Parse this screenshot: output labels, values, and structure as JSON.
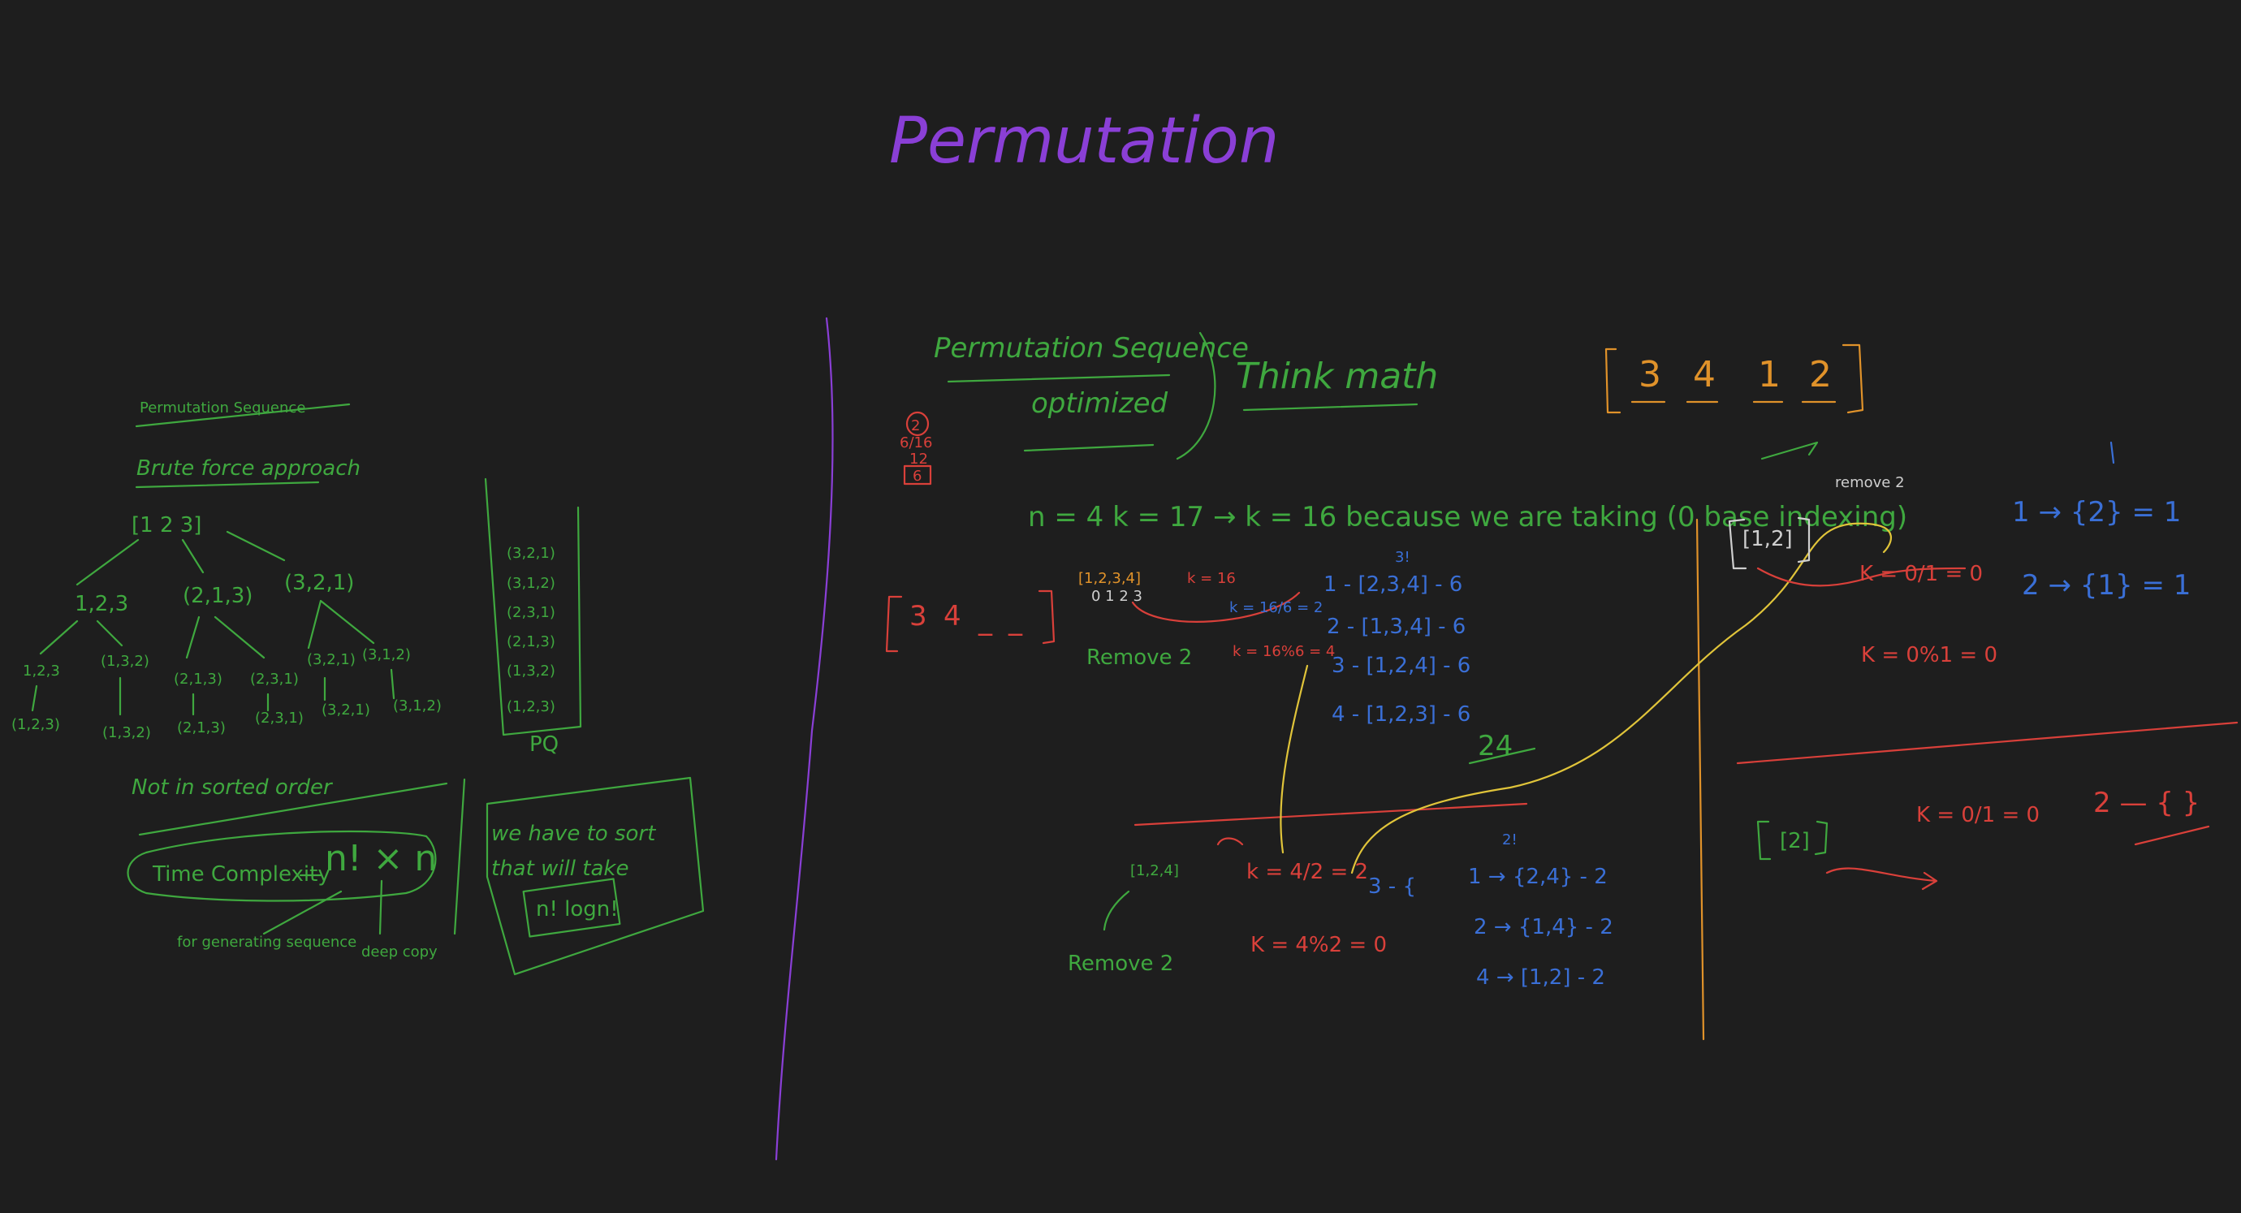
{
  "title": "Permutation",
  "left": {
    "heading": "Permutation Sequence",
    "approach": "Brute force approach",
    "root": "[1 2 3]",
    "level1": [
      "1,2,3",
      "(2,1,3)",
      "(3,2,1)"
    ],
    "level2": [
      "1,2,3",
      "(1,3,2)",
      "(2,1,3)",
      "(2,3,1)",
      "(3,2,1)",
      "(3,1,2)"
    ],
    "level3": [
      "(1,2,3)",
      "(1,3,2)",
      "(2,1,3)",
      "(2,3,1)",
      "(3,2,1)",
      "(3,1,2)"
    ],
    "pq_items": [
      "(3,2,1)",
      "(3,1,2)",
      "(2,3,1)",
      "(2,1,3)",
      "(1,3,2)",
      "(1,2,3)"
    ],
    "pq_label": "PQ",
    "not_sorted": "Not in sorted order",
    "complexity_label": "Time Complexity",
    "complexity_value": "n! × n",
    "note_generating": "for generating sequence",
    "note_deep": "deep copy",
    "sort_note_1": "we have to sort",
    "sort_note_2": "that will take",
    "sort_cost": "n! logn!"
  },
  "right": {
    "heading": "Permutation Sequence",
    "subheading": "optimized",
    "think": "Think math",
    "answer": [
      "3",
      "4",
      "1",
      "2"
    ],
    "stack": [
      "2",
      "6/16",
      "12",
      "6"
    ],
    "given": "n = 4    k = 17  → k = 16  because we are taking (0 base indexing)",
    "partial": [
      "3",
      "4",
      "_",
      "_"
    ],
    "set1": "[1,2,3,4]",
    "idx1": "0 1 2 3",
    "k1": "k = 16",
    "kdiv1": "k = 16/6 = 2",
    "kmod1": "k = 16%6 = 4",
    "remove1": "Remove 2",
    "top_count": "3!",
    "groups1": [
      "1 - [2,3,4] - 6",
      "2 - [1,3,4] - 6",
      "3 - [1,2,4] - 6",
      "4 - [1,2,3] - 6"
    ],
    "total1": "24",
    "set2": "[1,2,4]",
    "kdiv2": "k = 4/2 = 2",
    "kmod2": "K = 4%2 = 0",
    "remove2": "Remove 2",
    "mid_count": "2!",
    "groups2_head": "3 - {",
    "groups2": [
      "1 → {2,4} - 2",
      "2 → {1,4} - 2",
      "4 → [1,2] - 2"
    ],
    "set3": "[1,2]",
    "remove3": "remove 2",
    "k3": "K = 0/1 = 0",
    "k4": "K = 0%1 = 0",
    "groups3": [
      "1 → {2} = 1",
      "2 → {1} = 1"
    ],
    "set4": "[2]",
    "k5": "K = 0/1 = 0",
    "final": "2 — { }"
  }
}
